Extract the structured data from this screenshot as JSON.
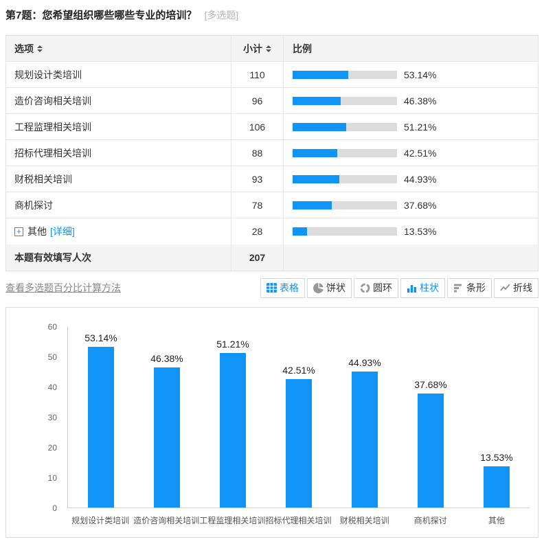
{
  "page": {
    "title": "第7题：您希望组织哪些哪些专业的培训？",
    "title_tag": "[多选题]"
  },
  "colors": {
    "accent": "#1094f5",
    "bar_track": "#dcdcdc"
  },
  "icons": {
    "plus_glyph": "+"
  },
  "table": {
    "headers": {
      "option": "选项",
      "count": "小计",
      "ratio": "比例"
    },
    "rows": [
      {
        "option": "规划设计类培训",
        "count": "110",
        "percent": 53.14,
        "percent_label": "53.14%"
      },
      {
        "option": "造价咨询相关培训",
        "count": "96",
        "percent": 46.38,
        "percent_label": "46.38%"
      },
      {
        "option": "工程监理相关培训",
        "count": "106",
        "percent": 51.21,
        "percent_label": "51.21%"
      },
      {
        "option": "招标代理相关培训",
        "count": "88",
        "percent": 42.51,
        "percent_label": "42.51%"
      },
      {
        "option": "财税相关培训",
        "count": "93",
        "percent": 44.93,
        "percent_label": "44.93%"
      },
      {
        "option": "商机探讨",
        "count": "78",
        "percent": 37.68,
        "percent_label": "37.68%"
      },
      {
        "option": "其他",
        "count": "28",
        "percent": 13.53,
        "percent_label": "13.53%",
        "expandable": true,
        "detail_label": "[详细]"
      }
    ],
    "footer": {
      "label": "本题有效填写人次",
      "count": "207"
    }
  },
  "toolbar": {
    "method_link": "查看多选题百分比计算方法",
    "buttons": [
      {
        "label": "表格",
        "icon": "table-icon",
        "active": true
      },
      {
        "label": "饼状",
        "icon": "pie-icon",
        "active": false
      },
      {
        "label": "圆环",
        "icon": "donut-icon",
        "active": false
      },
      {
        "label": "柱状",
        "icon": "column-icon",
        "active": true
      },
      {
        "label": "条形",
        "icon": "hbars-icon",
        "active": false
      },
      {
        "label": "折线",
        "icon": "line-icon",
        "active": false
      }
    ]
  },
  "chart_data": {
    "type": "bar",
    "title": "",
    "xlabel": "",
    "ylabel": "",
    "categories": [
      "规划设计类培训",
      "造价咨询相关培训",
      "工程监理相关培训",
      "招标代理相关培训",
      "财税相关培训",
      "商机探讨",
      "其他"
    ],
    "values": [
      53.14,
      46.38,
      51.21,
      42.51,
      44.93,
      37.68,
      13.53
    ],
    "value_labels": [
      "53.14%",
      "46.38%",
      "51.21%",
      "42.51%",
      "44.93%",
      "37.68%",
      "13.53%"
    ],
    "ylim": [
      0,
      60
    ],
    "yticks": [
      0,
      10,
      20,
      30,
      40,
      50,
      60
    ],
    "bar_color": "#1094f5",
    "grid": false,
    "legend": "none"
  }
}
